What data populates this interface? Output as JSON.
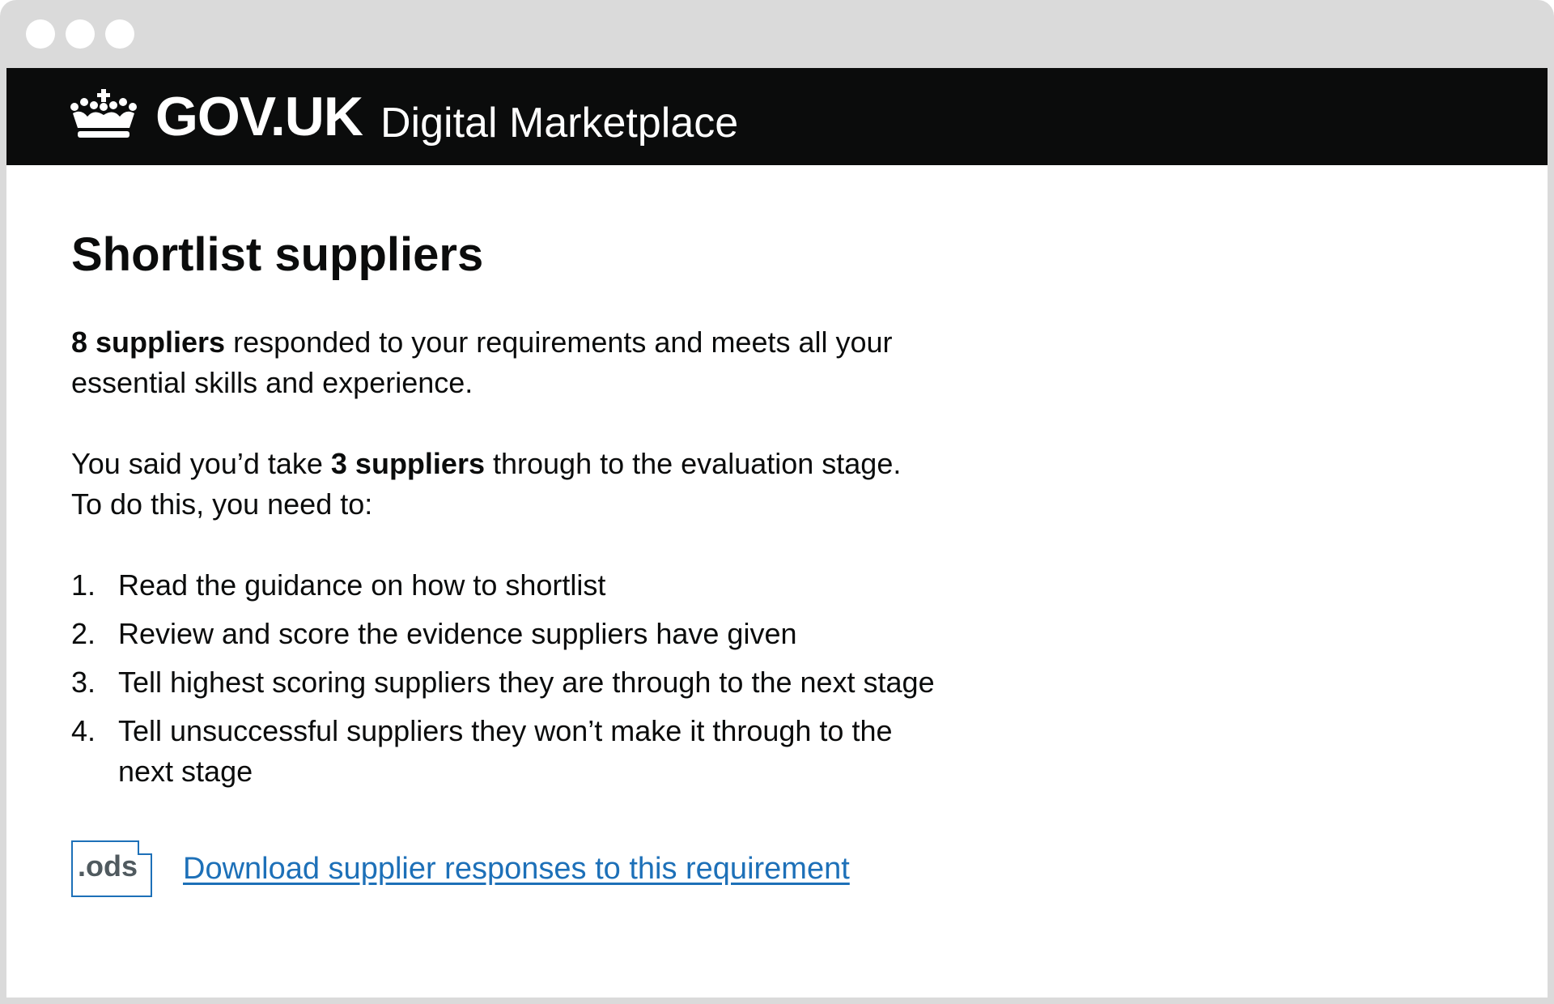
{
  "browser": {
    "window_dots": [
      "close",
      "minimise",
      "maximise"
    ]
  },
  "header": {
    "logo_text": "GOV.UK",
    "service_name": "Digital Marketplace",
    "logo_icon": "crown-icon",
    "background": "#0b0c0c"
  },
  "main": {
    "title": "Shortlist suppliers",
    "paragraph1": {
      "bold": "8 suppliers",
      "text": " responded to your requirements and meets all your essential skills and experience."
    },
    "paragraph2": {
      "before": "You said you’d take ",
      "bold": "3 suppliers",
      "after": " through to the evaluation stage. To do this, you need to:"
    },
    "steps": [
      {
        "num": "1.",
        "text": "Read the guidance on how to shortlist"
      },
      {
        "num": "2.",
        "text": "Review and score the evidence suppliers have given"
      },
      {
        "num": "3.",
        "text": "Tell highest scoring suppliers they are through to the next stage"
      },
      {
        "num": "4.",
        "text": "Tell unsuccessful suppliers they won’t make it through to the next stage"
      }
    ],
    "download": {
      "file_type": ".ods",
      "link_text": "Download supplier responses to this requirement",
      "link_color": "#1d70b8"
    }
  }
}
